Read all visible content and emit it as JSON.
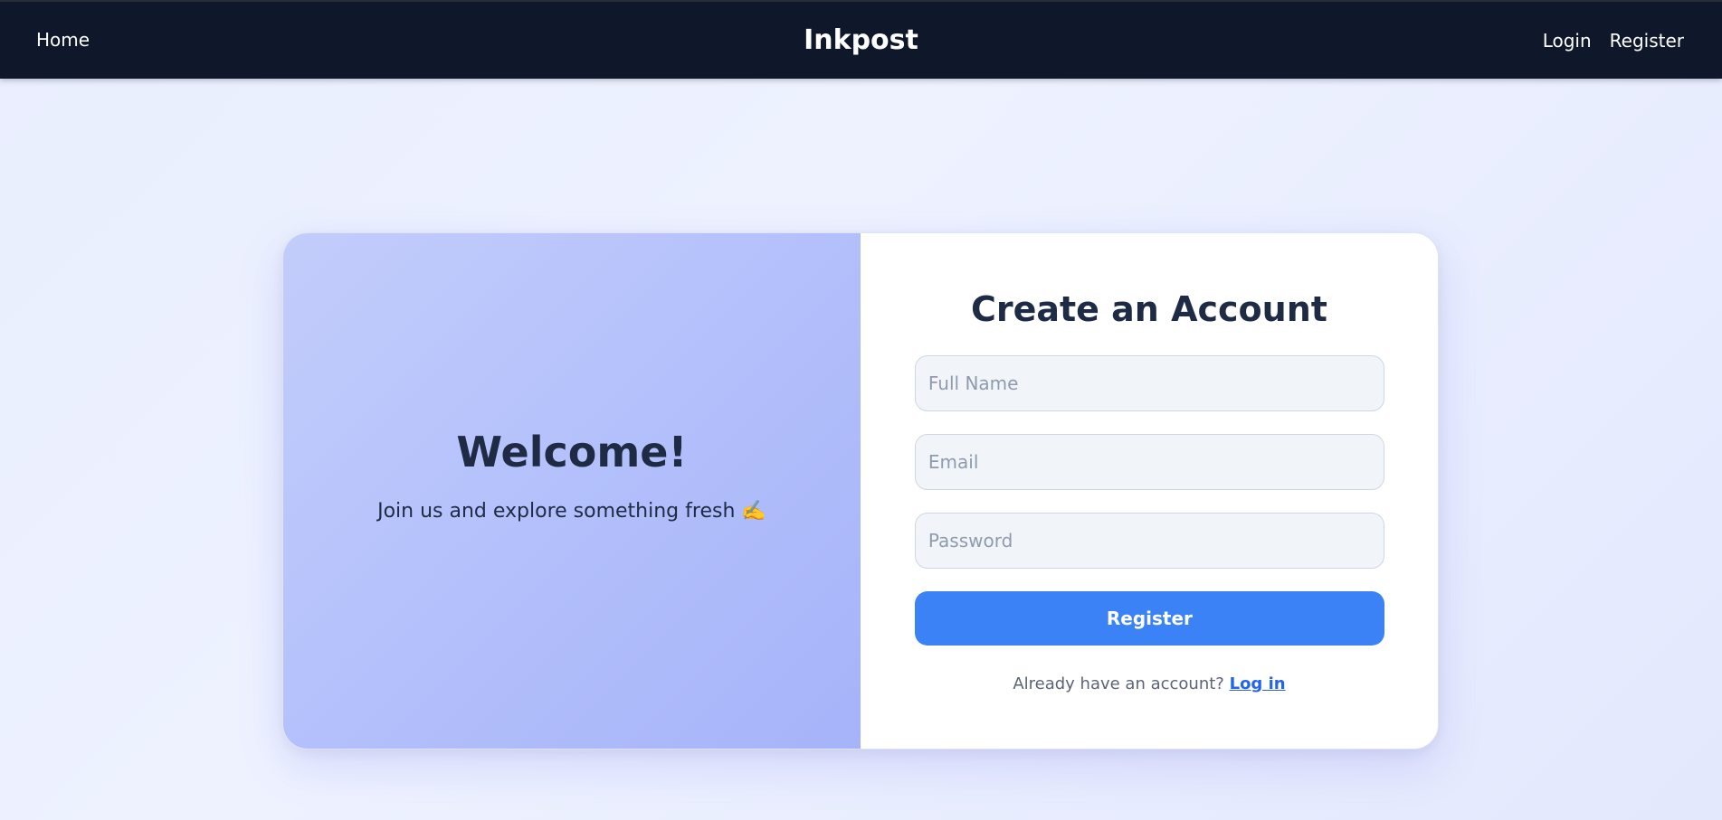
{
  "colors": {
    "navbar_bg": "#0f172a",
    "accent": "#3b82f6",
    "link": "#2563eb",
    "heading": "#1f2a44"
  },
  "navbar": {
    "home_label": "Home",
    "brand": "Inkpost",
    "login_label": "Login",
    "register_label": "Register"
  },
  "welcome": {
    "title": "Welcome!",
    "subtitle": "Join us and explore something fresh ✍️"
  },
  "form": {
    "title": "Create an Account",
    "full_name": {
      "placeholder": "Full Name",
      "value": ""
    },
    "email": {
      "placeholder": "Email",
      "value": ""
    },
    "password": {
      "placeholder": "Password",
      "value": ""
    },
    "submit_label": "Register",
    "footer_text": "Already have an account?",
    "login_link_label": "Log in"
  }
}
